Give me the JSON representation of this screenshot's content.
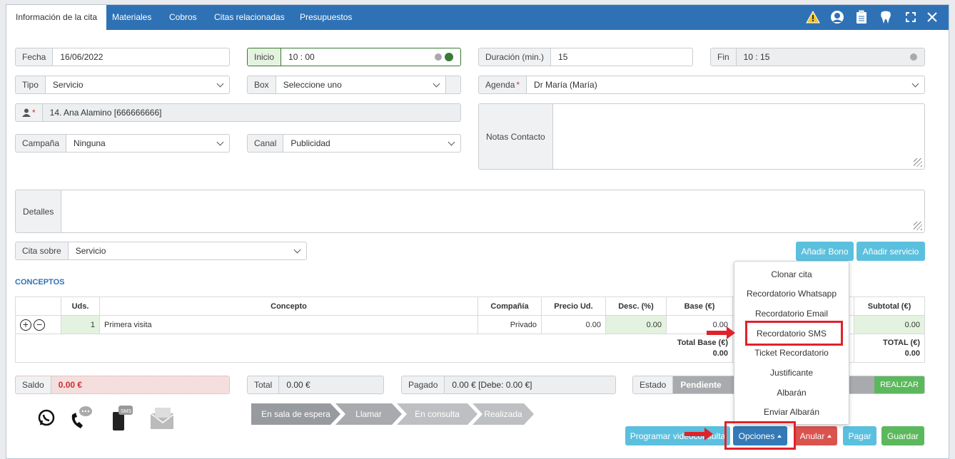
{
  "tabs": [
    "Información de la cita",
    "Materiales",
    "Cobros",
    "Citas relacionadas",
    "Presupuestos"
  ],
  "header_icons": [
    "warning-icon",
    "user-icon",
    "clipboard-icon",
    "tooth-icon",
    "fullscreen-icon",
    "close-icon"
  ],
  "form": {
    "fecha": {
      "label": "Fecha",
      "value": "16/06/2022"
    },
    "inicio": {
      "label": "Inicio",
      "value": "10 : 00"
    },
    "duracion": {
      "label": "Duración (min.)",
      "value": "15"
    },
    "fin": {
      "label": "Fin",
      "value": "10 : 15"
    },
    "tipo": {
      "label": "Tipo",
      "value": "Servicio"
    },
    "box": {
      "label": "Box",
      "value": "Seleccione uno"
    },
    "agenda": {
      "label": "Agenda",
      "required": "*",
      "value": "Dr María (María)"
    },
    "paciente": {
      "required": "*",
      "value": "14. Ana Alamino [666666666]"
    },
    "campana": {
      "label": "Campaña",
      "value": "Ninguna"
    },
    "canal": {
      "label": "Canal",
      "value": "Publicidad"
    },
    "notas": {
      "label": "Notas Contacto"
    },
    "detalles": {
      "label": "Detalles"
    },
    "cita_sobre": {
      "label": "Cita sobre",
      "value": "Servicio"
    }
  },
  "buttons": {
    "anadir_bono": "Añadir Bono",
    "anadir_servicio": "Añadir servicio",
    "programar": "Programar videoconsulta",
    "opciones": "Opciones",
    "anular": "Anular",
    "pagar": "Pagar",
    "guardar": "Guardar",
    "realizar": "REALIZAR"
  },
  "conceptos": {
    "title": "CONCEPTOS",
    "headers": [
      "Uds.",
      "Concepto",
      "Compañía",
      "Precio Ud.",
      "Desc. (%)",
      "Base (€)",
      "Subtotal (€)"
    ],
    "row": {
      "uds": "1",
      "concepto": "Primera visita",
      "compania": "Privado",
      "precio": "0.00",
      "desc": "0.00",
      "base": "0.00",
      "subtotal": "0.00"
    },
    "total_base_label": "Total Base (€)",
    "total_base": "0.00",
    "total_label": "TOTAL (€)",
    "total": "0.00"
  },
  "summary": {
    "saldo": {
      "label": "Saldo",
      "value": "0.00 €"
    },
    "total": {
      "label": "Total",
      "value": "0.00 €"
    },
    "pagado": {
      "label": "Pagado",
      "value": "0.00 € [Debe: 0.00 €]"
    },
    "estado": {
      "label": "Estado",
      "value": "Pendiente"
    }
  },
  "steps": [
    "En sala de espera",
    "Llamar",
    "En consulta",
    "Realizada"
  ],
  "comm_icons": [
    "whatsapp-icon",
    "phone-icon",
    "sms-icon",
    "email-icon"
  ],
  "menu": [
    "Clonar cita",
    "Recordatorio Whatsapp",
    "Recordatorio Email",
    "Recordatorio SMS",
    "Ticket Recordatorio",
    "Justificante",
    "Albarán",
    "Enviar Albarán"
  ],
  "colors": {
    "header": "#2e72b5",
    "info_button": "#5bc0de",
    "danger": "#d9534f",
    "success": "#5cb85c",
    "primary": "#337ab7",
    "highlight": "#e0222a"
  }
}
